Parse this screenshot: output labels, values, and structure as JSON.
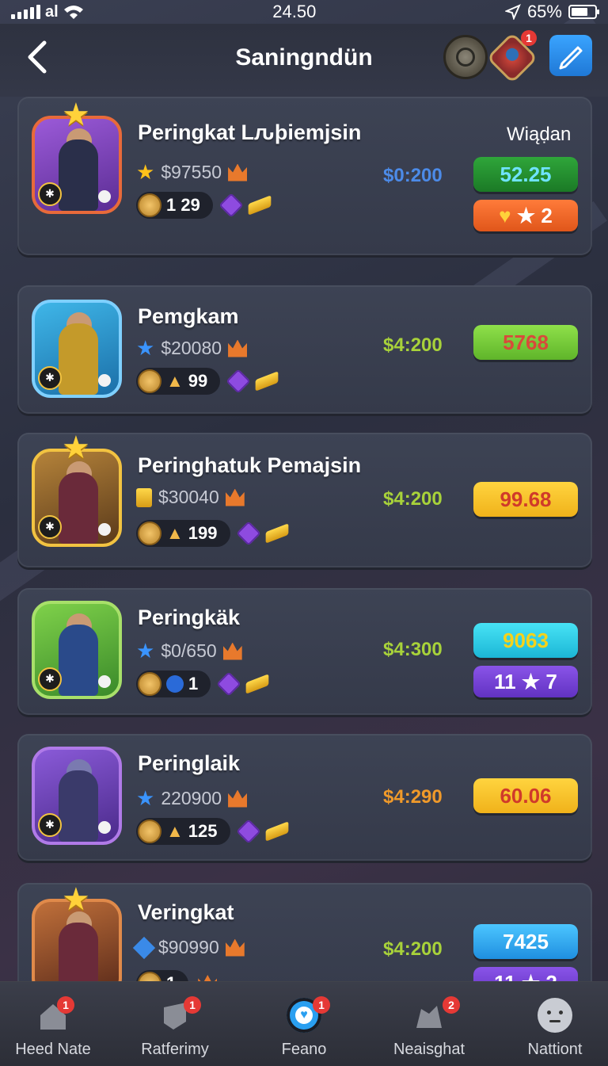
{
  "status": {
    "time": "24.50",
    "battery": "65%"
  },
  "header": {
    "title": "Saningndün"
  },
  "header_badge": "1",
  "rows": [
    {
      "name": "Peringkat Lԉþiemjsin",
      "value": "$97550",
      "pill": "1 29",
      "price": "$0:200",
      "price_color": "#4c8be8",
      "label": "Wiąḍan",
      "btn1": "52.25",
      "btn2": "★ 2"
    },
    {
      "name": "Pemgkam",
      "value": "$20080",
      "pill": "99",
      "price": "$4:200",
      "price_color": "#a8d23a",
      "btn1": "5768"
    },
    {
      "name": "Peringhatuk Pemajsin",
      "value": "$30040",
      "pill": "199",
      "price": "$4:200",
      "price_color": "#a8d23a",
      "btn1": "99.68"
    },
    {
      "name": "Peringkäk",
      "value": "$0/650",
      "pill": "1",
      "price": "$4:300",
      "price_color": "#a8d23a",
      "btn1": "9063",
      "btn2": "11 ★ 7"
    },
    {
      "name": "Peringlaik",
      "value": "220900",
      "pill": "125",
      "price": "$4:290",
      "price_color": "#f09a2a",
      "btn1": "60.06"
    },
    {
      "name": "Veringkat",
      "value": "$90990",
      "pill": "1",
      "price": "$4:200",
      "price_color": "#a8d23a",
      "btn1": "7425",
      "btn2": "11 ★ 2"
    }
  ],
  "tabs": [
    {
      "label": "Heed Nate",
      "badge": "1"
    },
    {
      "label": "Ratferimy",
      "badge": "1"
    },
    {
      "label": "Feano",
      "badge": "1"
    },
    {
      "label": "Neaisghat",
      "badge": "2"
    },
    {
      "label": "Nattiont"
    }
  ],
  "colors": {
    "accent": "#3aa4ff",
    "badge": "#e53935"
  }
}
